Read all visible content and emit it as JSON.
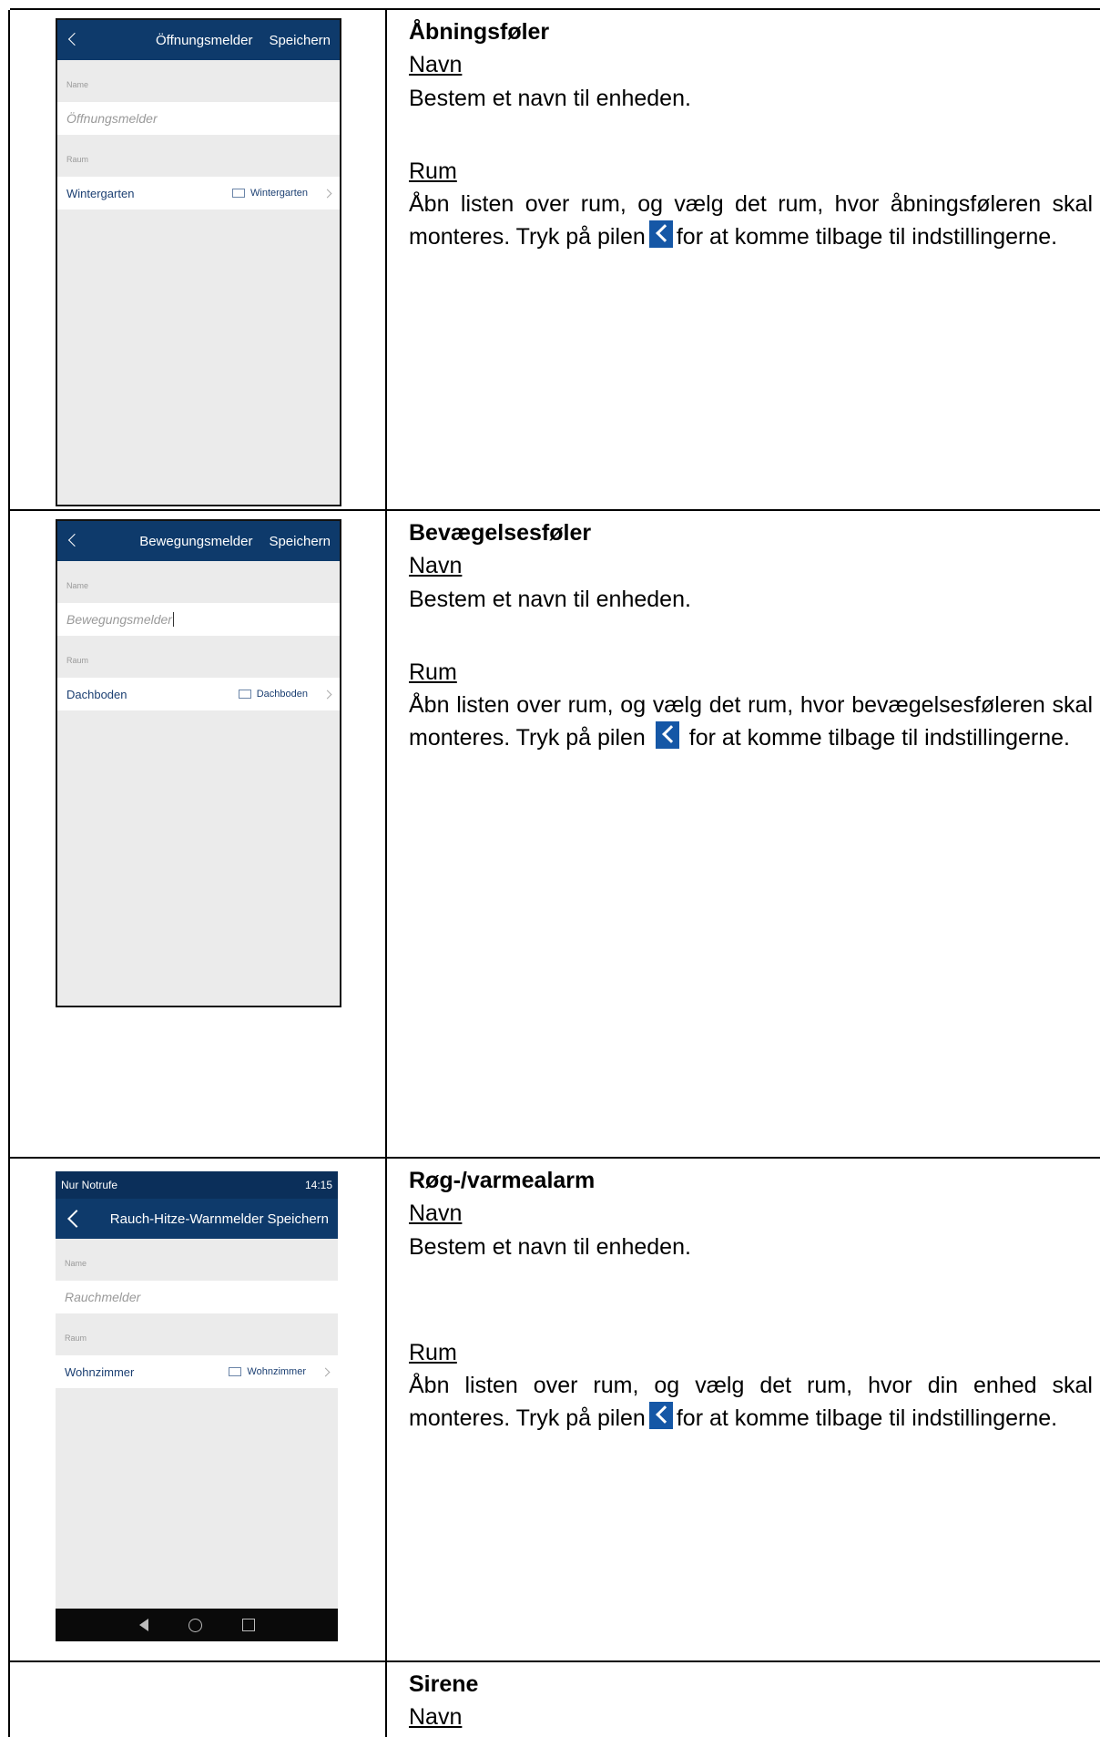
{
  "rows": [
    {
      "phone": {
        "title": "Öffnungsmelder",
        "save": "Speichern",
        "name_label": "Name",
        "name_value": "Öffnungsmelder",
        "room_label": "Raum",
        "room_name": "Wintergarten",
        "room_value": "Wintergarten"
      },
      "heading": "Åbningsføler",
      "name_sub": "Navn",
      "name_text": "Bestem et navn til enheden.",
      "room_sub": "Rum",
      "room_text_1": "Åbn listen over rum, og vælg det rum, hvor åbningsføleren skal monteres. Tryk på pilen",
      "room_text_2": "for at komme tilbage til indstillingerne."
    },
    {
      "phone": {
        "title": "Bewegungsmelder",
        "save": "Speichern",
        "name_label": "Name",
        "name_value": "Bewegungsmelder",
        "room_label": "Raum",
        "room_name": "Dachboden",
        "room_value": "Dachboden"
      },
      "heading": "Bevægelsesføler",
      "name_sub": "Navn",
      "name_text": "Bestem et navn til enheden.",
      "room_sub": "Rum",
      "room_text_1": "Åbn listen over rum, og vælg det rum, hvor bevægelsesføleren skal monteres. Tryk på pilen",
      "room_text_2": "for at komme tilbage til indstillingerne."
    },
    {
      "phone": {
        "status_left": "Nur Notrufe",
        "status_time": "14:15",
        "title": "Rauch-Hitze-Warnmelder",
        "save": "Speichern",
        "name_label": "Name",
        "name_value": "Rauchmelder",
        "room_label": "Raum",
        "room_name": "Wohnzimmer",
        "room_value": "Wohnzimmer"
      },
      "heading": "Røg-/varmealarm",
      "name_sub": "Navn",
      "name_text": "Bestem et navn til enheden.",
      "room_sub": "Rum",
      "room_text_1": "Åbn listen over rum, og vælg det rum, hvor din enhed skal monteres. Tryk på pilen",
      "room_text_2": "for at komme tilbage til indstillingerne."
    },
    {
      "heading": "Sirene",
      "name_sub": "Navn"
    }
  ],
  "colors": {
    "accent": "#1557a6",
    "appbar": "#0e3a6b"
  }
}
